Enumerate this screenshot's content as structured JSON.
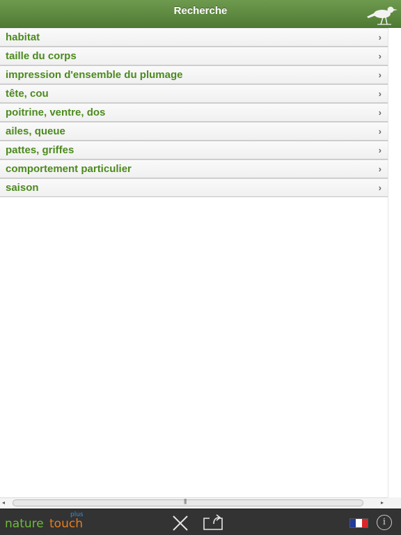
{
  "header": {
    "title": "Recherche",
    "icon": "bird-icon"
  },
  "list": {
    "items": [
      {
        "label": "habitat"
      },
      {
        "label": "taille du corps"
      },
      {
        "label": "impression d'ensemble du plumage"
      },
      {
        "label": "tête, cou"
      },
      {
        "label": "poitrine, ventre, dos"
      },
      {
        "label": "ailes, queue"
      },
      {
        "label": "pattes, griffes"
      },
      {
        "label": "comportement particulier"
      },
      {
        "label": "saison"
      }
    ],
    "chevron": "›",
    "label_color": "#4c8a1e"
  },
  "scrollbar": {
    "left_arrow": "◂",
    "right_arrow": "▸",
    "grip": "|||"
  },
  "toolbar": {
    "logo": {
      "part1": "nature",
      "part2": "touch",
      "sup": "plus"
    },
    "close_icon": "close-icon",
    "share_icon": "share-icon",
    "language_flag": "flag-fr-icon",
    "info_label": "i"
  },
  "colors": {
    "header": "#5a8540",
    "toolbar": "#333333",
    "accent": "#4c8a1e"
  }
}
